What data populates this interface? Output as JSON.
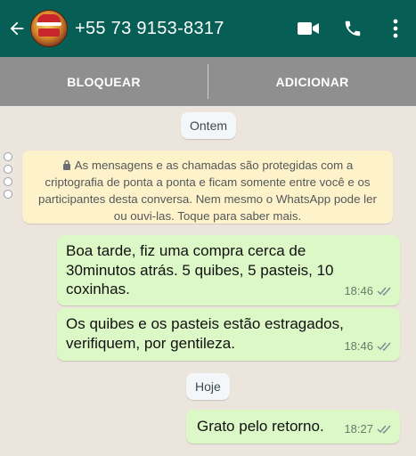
{
  "header": {
    "contact": "+55 73 9153-8317",
    "icons": [
      "arrow-back-icon",
      "video-call-icon",
      "phone-icon",
      "more-vert-icon"
    ]
  },
  "actions": {
    "block_label": "BLOQUEAR",
    "add_label": "ADICIONAR"
  },
  "chat": {
    "date_yesterday": "Ontem",
    "date_today": "Hoje",
    "notice": "As mensagens e as chamadas são protegidas com a criptografia de ponta a ponta e ficam somente entre você e os participantes desta conversa. Nem mesmo o WhatsApp pode ler ou ouvi-las. Toque para saber mais.",
    "messages": [
      {
        "text": "Boa tarde, fiz uma compra cerca de\n30minutos atrás. 5 quibes, 5 pasteis, 10\ncoxinhas.",
        "time": "18:46",
        "status": "read-ticks-icon"
      },
      {
        "text": "Os quibes e os pasteis estão estragados,\nverifiquem, por gentileza.",
        "time": "18:46",
        "status": "read-ticks-icon"
      },
      {
        "text": "Grato pelo retorno.",
        "time": "18:27",
        "status": "read-ticks-icon"
      }
    ]
  },
  "colors": {
    "header": "#075e54",
    "action_bar": "#8f8f8f",
    "chat_bg": "#ece5dd",
    "outgoing_bubble": "#dcf8c6",
    "notice_bg": "#fdf2c9"
  }
}
